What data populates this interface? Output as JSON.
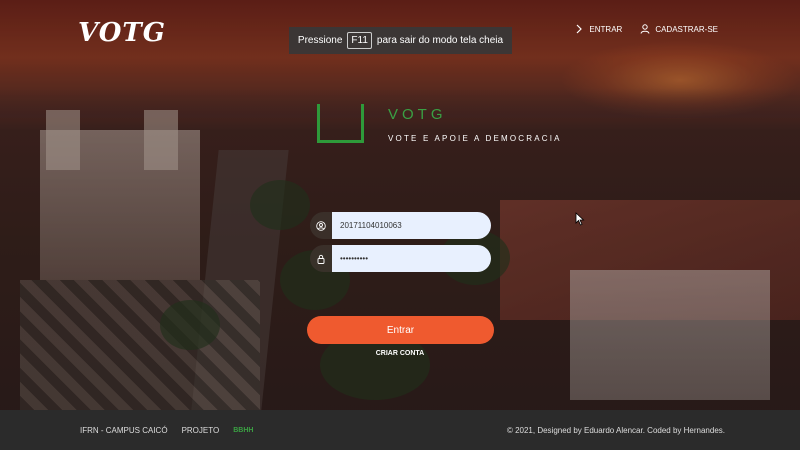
{
  "header": {
    "logo": "VOTG",
    "login_label": "ENTRAR",
    "register_label": "CADASTRAR-SE"
  },
  "fullscreen_notice": {
    "prefix": "Pressione",
    "key": "F11",
    "suffix": "para sair do modo tela cheia"
  },
  "brand": {
    "name": "VOTG",
    "tagline": "VOTE E APOIE A DEMOCRACIA"
  },
  "login": {
    "username_value": "20171104010063",
    "password_value": "••••••••••",
    "submit_label": "Entrar",
    "create_account_label": "CRIAR CONTA"
  },
  "footer": {
    "links": [
      "IFRN - CAMPUS CAICÓ",
      "PROJETO",
      "BBHH"
    ],
    "credit": "© 2021, Designed by Eduardo Alencar. Coded by Hernandes."
  },
  "colors": {
    "accent_green": "#3aa043",
    "button_orange": "#ef5a2f",
    "input_bg": "#e8f0fe",
    "footer_bg": "#2b2b2b"
  },
  "icons": {
    "login": "chevron-right-icon",
    "register": "user-icon",
    "username_field": "user-circle-icon",
    "password_field": "lock-icon",
    "cursor": "mouse-pointer-icon"
  }
}
